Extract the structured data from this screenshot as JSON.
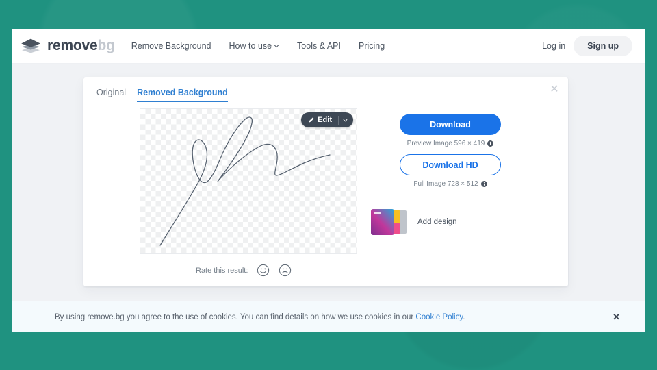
{
  "theme": {
    "canvas_green": "#1f9280",
    "page_bg": "#f0f2f5",
    "accent_blue": "#1a73e8",
    "tab_blue": "#2f7fd1",
    "dark_pill": "#3e4855",
    "cookie_bg": "#f4fafd"
  },
  "header": {
    "logo_icon": "layers-diamond-icon",
    "brand_name": "remove",
    "brand_suffix": "bg",
    "nav": [
      {
        "label": "Remove Background",
        "has_caret": false,
        "icon": ""
      },
      {
        "label": "How to use",
        "has_caret": true,
        "icon": "chevron-down-icon"
      },
      {
        "label": "Tools & API",
        "has_caret": false,
        "icon": ""
      },
      {
        "label": "Pricing",
        "has_caret": false,
        "icon": ""
      }
    ],
    "login_label": "Log in",
    "signup_label": "Sign up"
  },
  "card": {
    "close_icon": "close-icon",
    "close_glyph": "✕",
    "tabs": [
      {
        "label": "Original",
        "active": false
      },
      {
        "label": "Removed Background",
        "active": true
      }
    ],
    "preview": {
      "alt": "handwritten signature on transparent background",
      "background": "transparency-checkerboard"
    },
    "edit_button": {
      "label": "Edit",
      "icon": "pencil-icon",
      "dropdown_icon": "chevron-down-icon"
    },
    "rate": {
      "label": "Rate this result:",
      "positive_icon": "smiley-happy-icon",
      "negative_icon": "smiley-sad-icon"
    },
    "download": {
      "primary_label": "Download",
      "primary_note": "Preview Image 596 × 419",
      "primary_info_icon": "info-icon",
      "hd_label": "Download HD",
      "hd_note": "Full Image 728 × 512",
      "hd_info_icon": "info-icon"
    },
    "design": {
      "thumb_icon": "canva-design-thumbnail",
      "link_label": "Add design"
    }
  },
  "cookie": {
    "text_before": "By using remove.bg you agree to the use of cookies. You can find details on how we use cookies in our ",
    "link_label": "Cookie Policy",
    "text_after": ".",
    "close_icon": "close-icon",
    "close_glyph": "✕"
  }
}
